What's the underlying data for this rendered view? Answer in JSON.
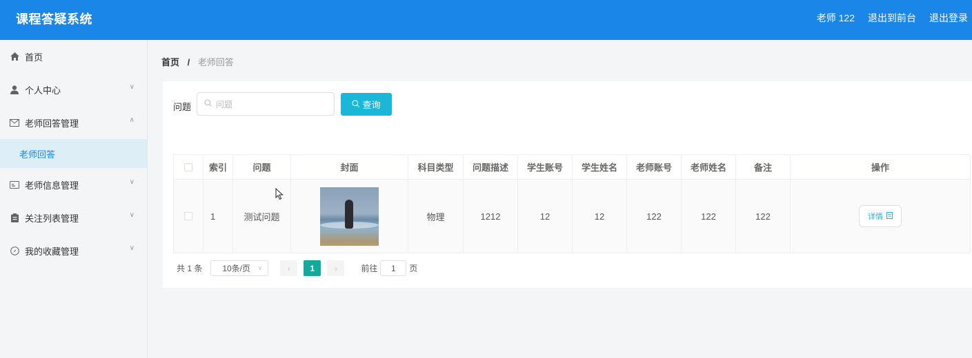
{
  "header": {
    "title": "课程答疑系统",
    "user": "老师 122",
    "front_link": "退出到前台",
    "logout": "退出登录"
  },
  "sidebar": {
    "items": [
      {
        "label": "首页",
        "icon": "home-icon"
      },
      {
        "label": "个人中心",
        "icon": "user-icon"
      },
      {
        "label": "老师回答管理",
        "icon": "mail-icon"
      },
      {
        "label": "老师回答",
        "icon": ""
      },
      {
        "label": "老师信息管理",
        "icon": "id-card-icon"
      },
      {
        "label": "关注列表管理",
        "icon": "clipboard-icon"
      },
      {
        "label": "我的收藏管理",
        "icon": "compass-icon"
      }
    ]
  },
  "breadcrumb": {
    "home": "首页",
    "separator": "/",
    "current": "老师回答"
  },
  "search": {
    "label": "问题",
    "placeholder": "问题",
    "button": "查询"
  },
  "table": {
    "headers": [
      "索引",
      "问题",
      "封面",
      "科目类型",
      "问题描述",
      "学生账号",
      "学生姓名",
      "老师账号",
      "老师姓名",
      "备注",
      "操作"
    ],
    "rows": [
      {
        "index": "1",
        "question": "测试问题",
        "subject": "物理",
        "description": "1212",
        "student_account": "12",
        "student_name": "12",
        "teacher_account": "122",
        "teacher_name": "122",
        "remark": "122",
        "action": "详情"
      }
    ]
  },
  "pagination": {
    "total": "共 1 条",
    "page_size": "10条/页",
    "current_page": "1",
    "goto_label": "前往",
    "goto_value": "1",
    "page_suffix": "页"
  },
  "colors": {
    "header_bg": "#1a86e8",
    "query_button": "#1ab7d8",
    "active_page": "#13a99c",
    "active_menu_bg": "#ddeef7"
  }
}
